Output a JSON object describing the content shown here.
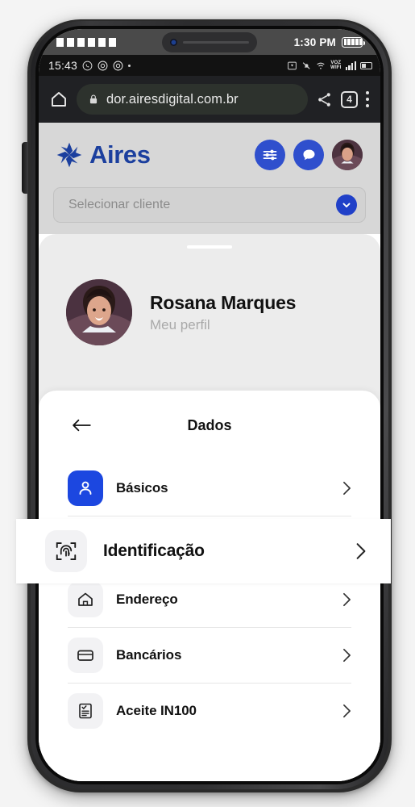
{
  "device": {
    "ios_status": {
      "time": "1:30 PM",
      "left_blocks": 6,
      "battery_icon": "battery-full-icon",
      "island_camera_icon": "front-camera-icon"
    },
    "android_status": {
      "clock": "15:43",
      "left_icons": [
        "whatsapp-icon",
        "chrome-icon",
        "chrome-icon",
        "dot-indicator"
      ],
      "right_icons": [
        "cast-icon",
        "mute-bell-icon",
        "wifi-calling-icon",
        "signal-bars-icon",
        "battery-icon"
      ],
      "voz_label_top": "VOZ",
      "voz_label_bottom": "WIFI"
    }
  },
  "browser": {
    "home_icon": "home-icon",
    "lock_icon": "lock-icon",
    "url": "dor.airesdigital.com.br",
    "share_icon": "share-icon",
    "tab_count": "4",
    "menu_icon": "kebab-menu-icon"
  },
  "app_header": {
    "brand_name": "Aires",
    "logo_icon": "aires-star-logo",
    "filter_icon": "sliders-icon",
    "chat_icon": "chat-bubble-icon",
    "avatar_icon": "user-avatar"
  },
  "client_selector": {
    "placeholder": "Selecionar cliente",
    "chevron_icon": "chevron-down-icon"
  },
  "profile": {
    "name": "Rosana Marques",
    "subtitle": "Meu perfil",
    "avatar_icon": "profile-photo"
  },
  "dados": {
    "title": "Dados",
    "back_icon": "arrow-left-icon",
    "items": [
      {
        "label": "Básicos",
        "icon": "person-icon",
        "chevron": "chevron-right-icon"
      },
      {
        "label": "Identificação",
        "icon": "fingerprint-scan-icon",
        "chevron": "chevron-right-icon"
      },
      {
        "label": "Endereço",
        "icon": "house-icon",
        "chevron": "chevron-right-icon"
      },
      {
        "label": "Bancários",
        "icon": "credit-card-icon",
        "chevron": "chevron-right-icon"
      },
      {
        "label": "Aceite IN100",
        "icon": "document-check-icon",
        "chevron": "chevron-right-icon"
      }
    ],
    "highlighted_item": "Identificação"
  },
  "colors": {
    "brand_blue": "#1b3f9e",
    "accent_blue": "#1c47e0",
    "button_blue": "#2f4fcd",
    "sheet_gray": "#ececec",
    "header_gray": "#d7d7d7"
  }
}
